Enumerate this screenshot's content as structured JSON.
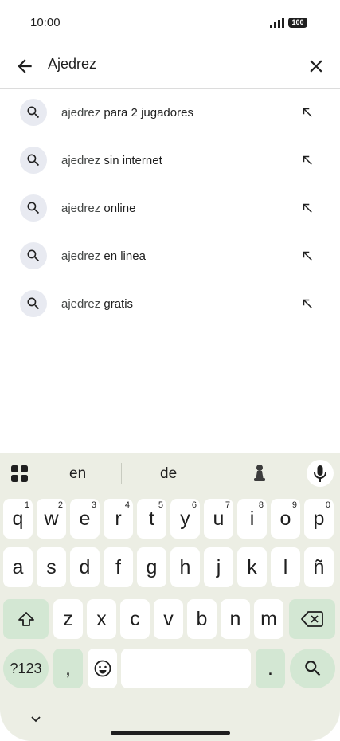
{
  "status": {
    "time": "10:00",
    "battery": "100"
  },
  "search": {
    "query": "Ajedrez"
  },
  "suggestions": [
    {
      "prefix": "ajedrez",
      "rest": " para 2 jugadores"
    },
    {
      "prefix": "ajedrez",
      "rest": " sin internet"
    },
    {
      "prefix": "ajedrez",
      "rest": " online"
    },
    {
      "prefix": "ajedrez",
      "rest": " en linea"
    },
    {
      "prefix": "ajedrez",
      "rest": " gratis"
    }
  ],
  "keyboard": {
    "predictions": [
      "en",
      "de"
    ],
    "row1": [
      "q",
      "w",
      "e",
      "r",
      "t",
      "y",
      "u",
      "i",
      "o",
      "p"
    ],
    "row1_hints": [
      "1",
      "2",
      "3",
      "4",
      "5",
      "6",
      "7",
      "8",
      "9",
      "0"
    ],
    "row2": [
      "a",
      "s",
      "d",
      "f",
      "g",
      "h",
      "j",
      "k",
      "l",
      "ñ"
    ],
    "row3": [
      "z",
      "x",
      "c",
      "v",
      "b",
      "n",
      "m"
    ],
    "symbols_label": "?123",
    "comma": ",",
    "period": "."
  },
  "colors": {
    "keyboard_bg": "#eceee4",
    "function_key": "#d3e7d3",
    "search_circle": "#e8eaf1"
  }
}
